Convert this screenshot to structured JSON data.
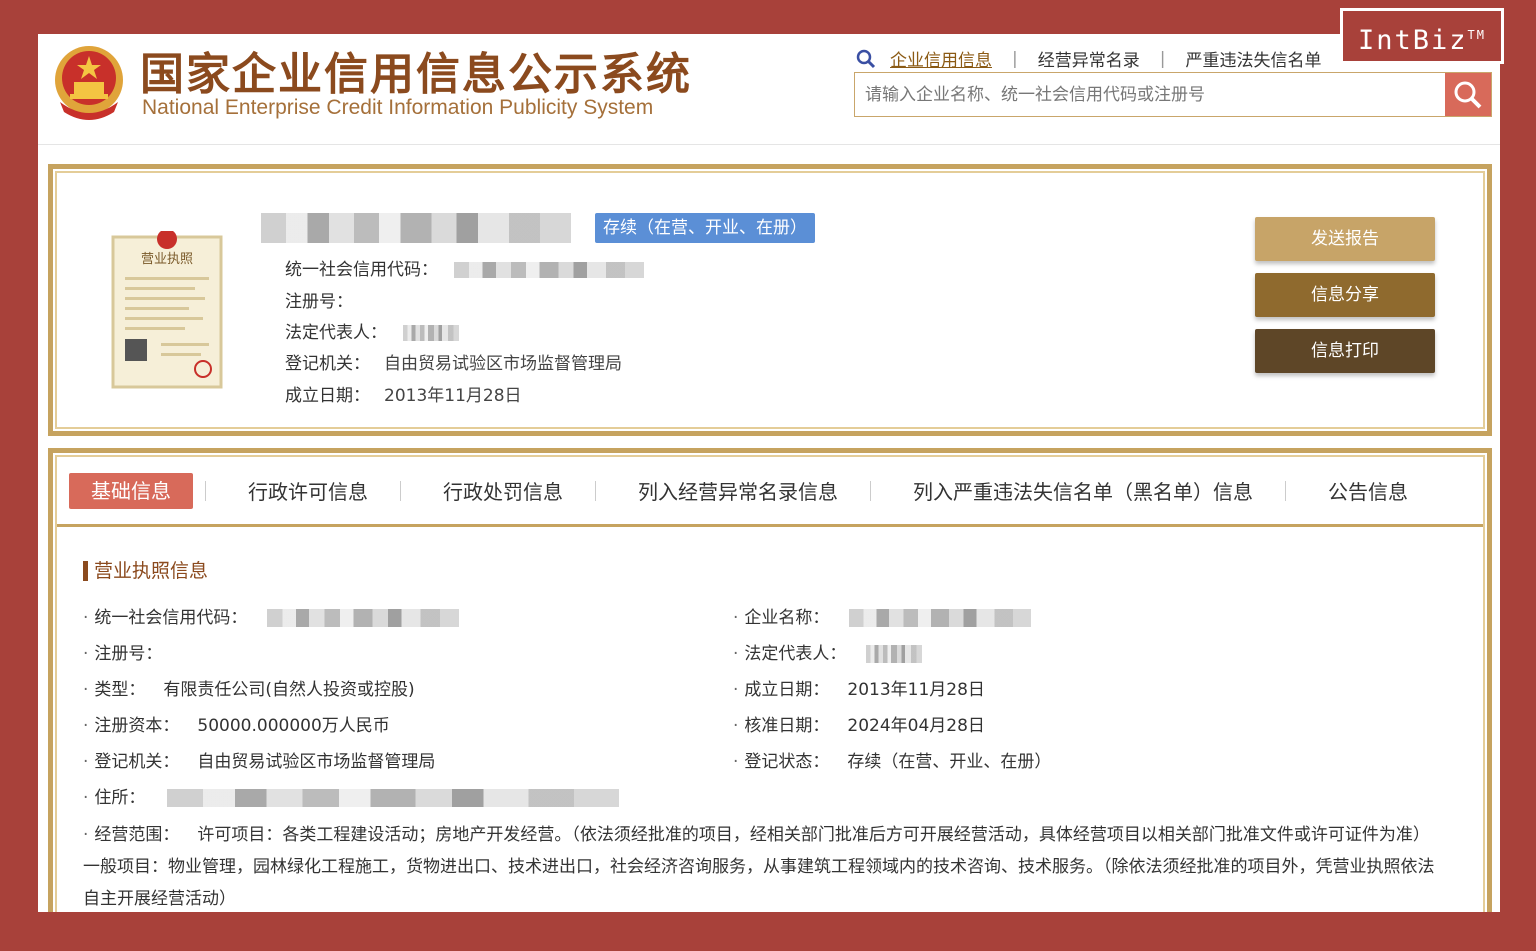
{
  "header": {
    "title_cn": "国家企业信用信息公示系统",
    "title_en": "National Enterprise Credit Information Publicity System",
    "nav": [
      "企业信用信息",
      "经营异常名录",
      "严重违法失信名单"
    ],
    "search_placeholder": "请输入企业名称、统一社会信用代码或注册号"
  },
  "watermark": {
    "text": "IntBiz",
    "tm": "TM"
  },
  "card": {
    "status": "存续（在营、开业、在册）",
    "fields": {
      "uscc_label": "统一社会信用代码：",
      "reg_no_label": "注册号：",
      "legal_rep_label": "法定代表人：",
      "authority_label": "登记机关：",
      "authority_value": "自由贸易试验区市场监督管理局",
      "founded_label": "成立日期：",
      "founded_value": "2013年11月28日"
    },
    "buttons": {
      "send": "发送报告",
      "share": "信息分享",
      "print": "信息打印"
    },
    "license_image_text": "营业执照"
  },
  "tabs": [
    "基础信息",
    "行政许可信息",
    "行政处罚信息",
    "列入经营异常名录信息",
    "列入严重违法失信名单（黑名单）信息",
    "公告信息"
  ],
  "section": {
    "title": "营业执照信息",
    "left": [
      {
        "label": "统一社会信用代码：",
        "value": ""
      },
      {
        "label": "注册号：",
        "value": ""
      },
      {
        "label": "类型：",
        "value": "有限责任公司(自然人投资或控股)"
      },
      {
        "label": "注册资本：",
        "value": "50000.000000万人民币"
      },
      {
        "label": "登记机关：",
        "value": "自由贸易试验区市场监督管理局"
      },
      {
        "label": "住所：",
        "value": ""
      }
    ],
    "right": [
      {
        "label": "企业名称：",
        "value": ""
      },
      {
        "label": "法定代表人：",
        "value": ""
      },
      {
        "label": "成立日期：",
        "value": "2013年11月28日"
      },
      {
        "label": "核准日期：",
        "value": "2024年04月28日"
      },
      {
        "label": "登记状态：",
        "value": "存续（在营、开业、在册）"
      }
    ],
    "scope_label": "经营范围：",
    "scope_value": "许可项目：各类工程建设活动；房地产开发经营。（依法须经批准的项目，经相关部门批准后方可开展经营活动，具体经营项目以相关部门批准文件或许可证件为准）一般项目：物业管理，园林绿化工程施工，货物进出口、技术进出口，社会经济咨询服务，从事建筑工程领域内的技术咨询、技术服务。（除依法须经批准的项目外，凭营业执照依法自主开展经营活动）"
  },
  "colors": {
    "frame": "#a8413a",
    "gold": "#c6a35f",
    "active_tab": "#d86a5a",
    "status_tag": "#5b8fd6",
    "title_brown": "#8b4a1e"
  }
}
